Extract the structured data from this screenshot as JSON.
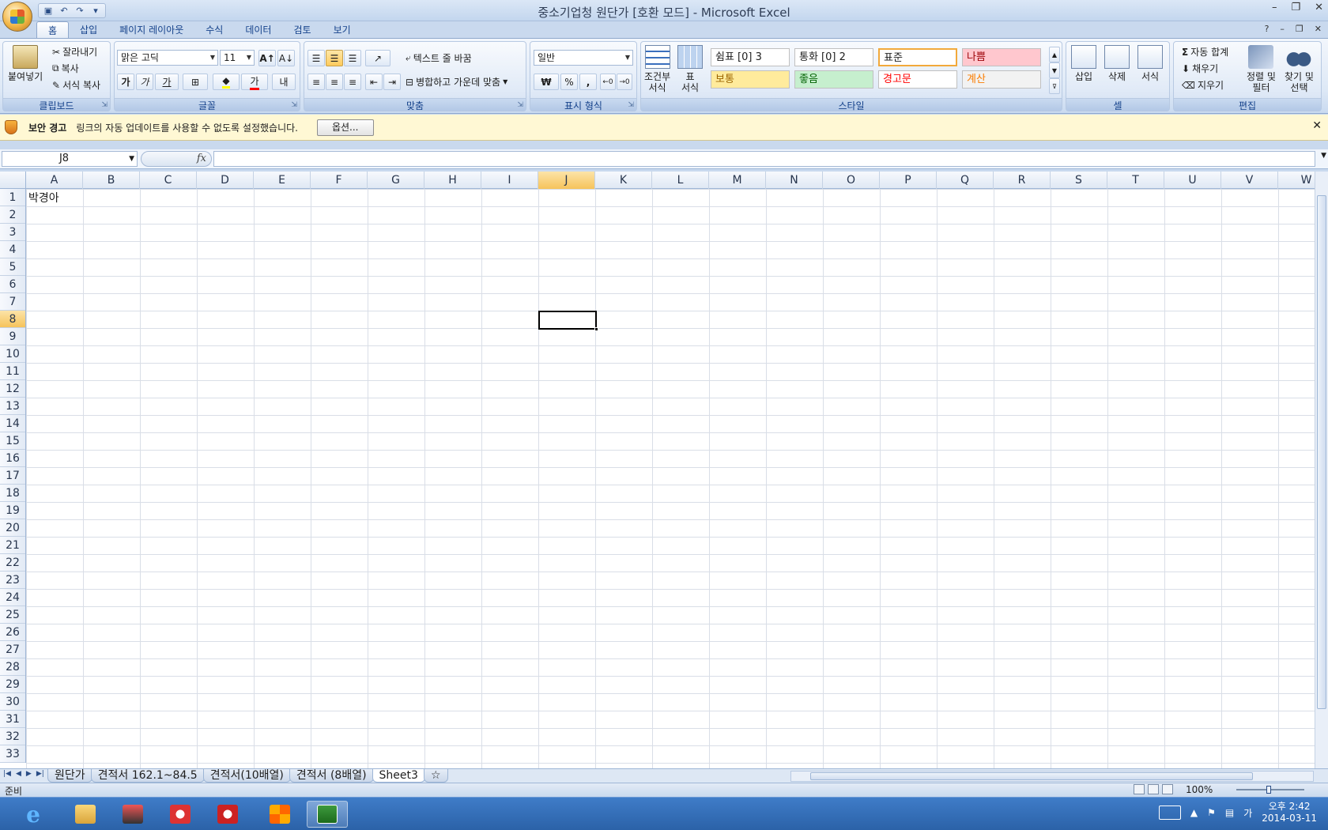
{
  "window": {
    "title": "중소기업청 원단가  [호환 모드] - Microsoft Excel"
  },
  "ribbon_tabs": [
    "홈",
    "삽입",
    "페이지 레이아웃",
    "수식",
    "데이터",
    "검토",
    "보기"
  ],
  "clipboard": {
    "paste": "붙여넣기",
    "cut": "잘라내기",
    "copy": "복사",
    "format_painter": "서식 복사",
    "label": "클립보드"
  },
  "font": {
    "name": "맑은 고딕",
    "size": "11",
    "label": "글꼴",
    "bold": "가",
    "italic": "가",
    "underline": "가",
    "color_a": "가"
  },
  "alignment": {
    "wrap_text": "텍스트 줄 바꿈",
    "merge_center": "병합하고 가운데 맞춤",
    "label": "맞춤"
  },
  "number": {
    "format": "일반",
    "currency": "₩",
    "percent": "%",
    "comma": ",",
    "label": "표시 형식"
  },
  "styles": {
    "conditional": "조건부",
    "conditional2": "서식",
    "table": "표",
    "table2": "서식",
    "cells": [
      {
        "text": "쉼표 [0] 3",
        "bg": "#ffffff",
        "color": "#1e1e1e"
      },
      {
        "text": "통화 [0] 2",
        "bg": "#ffffff",
        "color": "#1e1e1e"
      },
      {
        "text": "표준",
        "bg": "#ffffff",
        "color": "#1e1e1e"
      },
      {
        "text": "나쁨",
        "bg": "#ffc7ce",
        "color": "#9c0006"
      },
      {
        "text": "보통",
        "bg": "#ffeb9c",
        "color": "#9c6500"
      },
      {
        "text": "좋음",
        "bg": "#c6efce",
        "color": "#006100"
      },
      {
        "text": "경고문",
        "bg": "#ffffff",
        "color": "#ff0000"
      },
      {
        "text": "계산",
        "bg": "#f2f2f2",
        "color": "#fa7d00"
      }
    ],
    "label": "스타일"
  },
  "cells_group": {
    "insert": "삽입",
    "delete": "삭제",
    "format": "서식",
    "label": "셀"
  },
  "editing": {
    "autosum": "자동 합계",
    "fill": "채우기",
    "clear": "지우기",
    "sort_filter": "정렬 및",
    "sort_filter2": "필터",
    "find_select": "찾기 및",
    "find_select2": "선택",
    "label": "편집"
  },
  "security": {
    "title": "보안 경고",
    "message": "링크의 자동 업데이트를 사용할 수 없도록 설정했습니다.",
    "options": "옵션..."
  },
  "formula_bar": {
    "name_box": "J8",
    "fx": "fx",
    "content": ""
  },
  "columns": [
    "A",
    "B",
    "C",
    "D",
    "E",
    "F",
    "G",
    "H",
    "I",
    "J",
    "K",
    "L",
    "M",
    "N",
    "O",
    "P",
    "Q",
    "R",
    "S",
    "T",
    "U",
    "V",
    "W"
  ],
  "rows": [
    "1",
    "2",
    "3",
    "4",
    "5",
    "6",
    "7",
    "8",
    "9",
    "10",
    "11",
    "12",
    "13",
    "14",
    "15",
    "16",
    "17",
    "18",
    "19",
    "20",
    "21",
    "22",
    "23",
    "24",
    "25",
    "26",
    "27",
    "28",
    "29",
    "30",
    "31",
    "32",
    "33"
  ],
  "selected": {
    "col": "J",
    "row": "8"
  },
  "cell_A1": "박경아",
  "sheet_tabs": [
    {
      "name": "원단가",
      "active": false
    },
    {
      "name": "견적서 162.1~84.5",
      "active": false
    },
    {
      "name": "견적서(10배열)",
      "active": false
    },
    {
      "name": "견적서 (8배열)",
      "active": false
    },
    {
      "name": "Sheet3",
      "active": true
    }
  ],
  "status": {
    "ready": "준비",
    "zoom": "100%"
  },
  "taskbar": {
    "time": "오후 2:42",
    "date": "2014-03-11",
    "ime": "가"
  }
}
